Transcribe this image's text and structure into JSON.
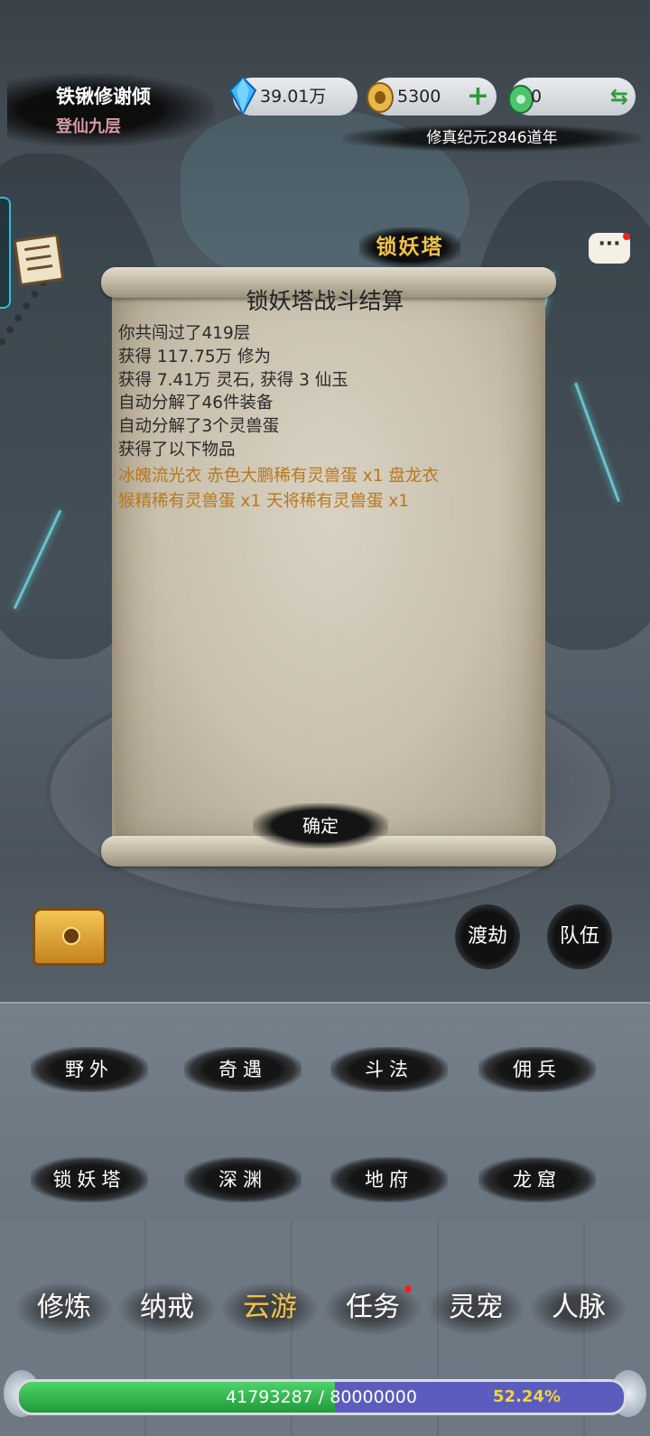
{
  "player": {
    "name": "铁锹修谢倾",
    "rank": "登仙九层"
  },
  "resources": {
    "spirit_stone": {
      "icon": "blue-crystal-icon",
      "value": "39.01万"
    },
    "coin": {
      "icon": "gold-coin-icon",
      "value": "5300",
      "action": "+"
    },
    "jade": {
      "icon": "green-jade-icon",
      "value": "0",
      "action": "⇆"
    }
  },
  "era": "修真纪元2846道年",
  "location_title": "锁妖塔",
  "dialog": {
    "title": "锁妖塔战斗结算",
    "lines": [
      "你共闯过了419层",
      "获得 117.75万 修为",
      "获得 7.41万 灵石, 获得 3 仙玉",
      "自动分解了46件装备",
      "自动分解了3个灵兽蛋",
      "获得了以下物品"
    ],
    "items": [
      "冰魄流光衣  赤色大鹏稀有灵兽蛋 x1  盘龙衣",
      "猴精稀有灵兽蛋 x1  天将稀有灵兽蛋 x1"
    ],
    "confirm": "确定"
  },
  "side_buttons": {
    "tribulation": "渡劫",
    "team": "队伍"
  },
  "chat_icon": "···",
  "activities": [
    "野外",
    "奇遇",
    "斗法",
    "佣兵",
    "锁妖塔",
    "深渊",
    "地府",
    "龙窟"
  ],
  "tabs": [
    "修炼",
    "纳戒",
    "云游",
    "任务",
    "灵宠",
    "人脉"
  ],
  "active_tab": "云游",
  "progress": {
    "text": "41793287 / 80000000",
    "current": 41793287,
    "max": 80000000,
    "percent": "52.24%"
  },
  "colors": {
    "accent_gold": "#f2c24a",
    "item_text": "#b8781e",
    "rank_pink": "#d79aa5"
  }
}
